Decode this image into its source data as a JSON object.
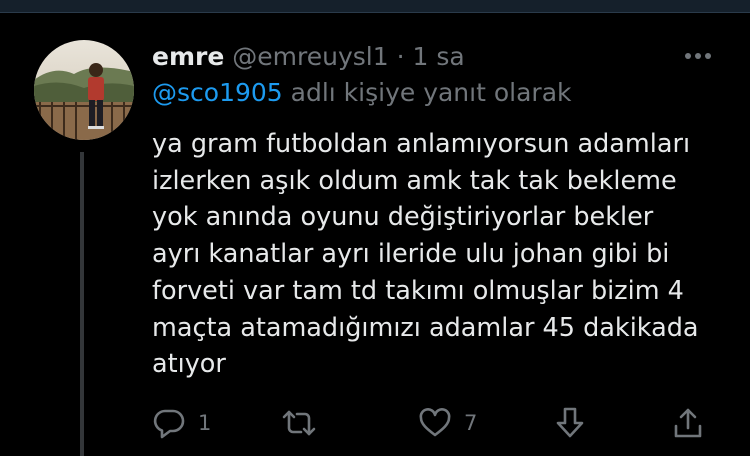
{
  "tweet": {
    "author_name": "emre",
    "author_handle": "@emreuysl1",
    "separator": "·",
    "time": "1 sa",
    "reply_to": {
      "mention": "@sco1905",
      "suffix": " adlı kişiye yanıt olarak"
    },
    "text_lines": [
      "ya gram futboldan anlamıyorsun adamları",
      "izlerken aşık oldum amk tak tak bekleme",
      "yok anında oyunu değiştiriyorlar bekler",
      "ayrı kanatlar ayrı ileride ulu johan gibi bi",
      "forveti var tam td takımı olmuşlar bizim 4",
      "maçta atamadığımızı adamlar 45 dakikada",
      "atıyor"
    ],
    "actions": {
      "reply": {
        "icon": "reply-icon",
        "count": "1"
      },
      "retweet": {
        "icon": "retweet-icon",
        "count": ""
      },
      "like": {
        "icon": "heart-icon",
        "count": "7"
      },
      "downvote": {
        "icon": "arrow-down-icon",
        "count": ""
      },
      "share": {
        "icon": "share-icon",
        "count": ""
      }
    }
  },
  "colors": {
    "background": "#000000",
    "text": "#e7e9ea",
    "muted": "#71767b",
    "link": "#1d9bf0",
    "thread_line": "#333639"
  }
}
